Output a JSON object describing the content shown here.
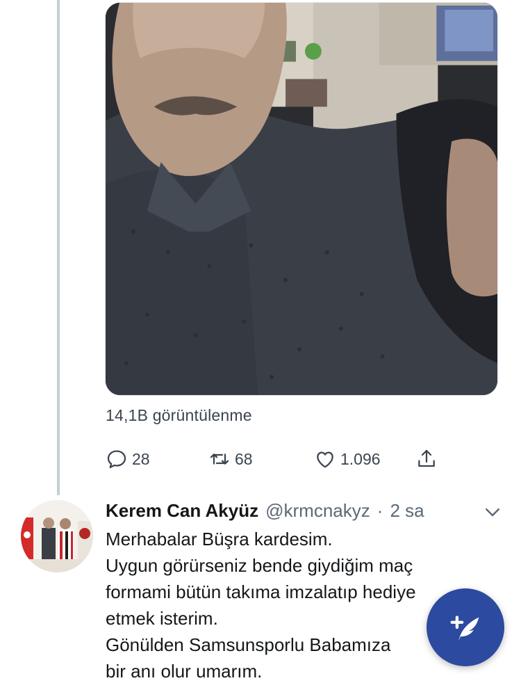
{
  "main_tweet": {
    "views": "14,1B görüntülenme",
    "actions": {
      "reply_count": "28",
      "retweet_count": "68",
      "like_count": "1.096"
    }
  },
  "reply_tweet": {
    "name": "Kerem Can Akyüz",
    "handle": "@krmcnakyz",
    "separator": "·",
    "time": "2 sa",
    "lines": [
      "Merhabalar Büşra kardesim.",
      "Uygun görürseniz bende giydiğim maç",
      "formami bütün takıma imzalatıp hediye",
      "etmek isterim.",
      "Gönülden Samsunsporlu Babamıza",
      "bir anı olur umarım."
    ]
  },
  "icons": {
    "reply": "reply-icon",
    "retweet": "retweet-icon",
    "like": "heart-icon",
    "share": "share-icon",
    "more": "chevron-down-icon",
    "compose": "compose-tweet-icon"
  },
  "colors": {
    "text": "#14171a",
    "secondary": "#5b6875",
    "thread_line": "#c4cfd6",
    "fab": "#2c4aa0"
  }
}
